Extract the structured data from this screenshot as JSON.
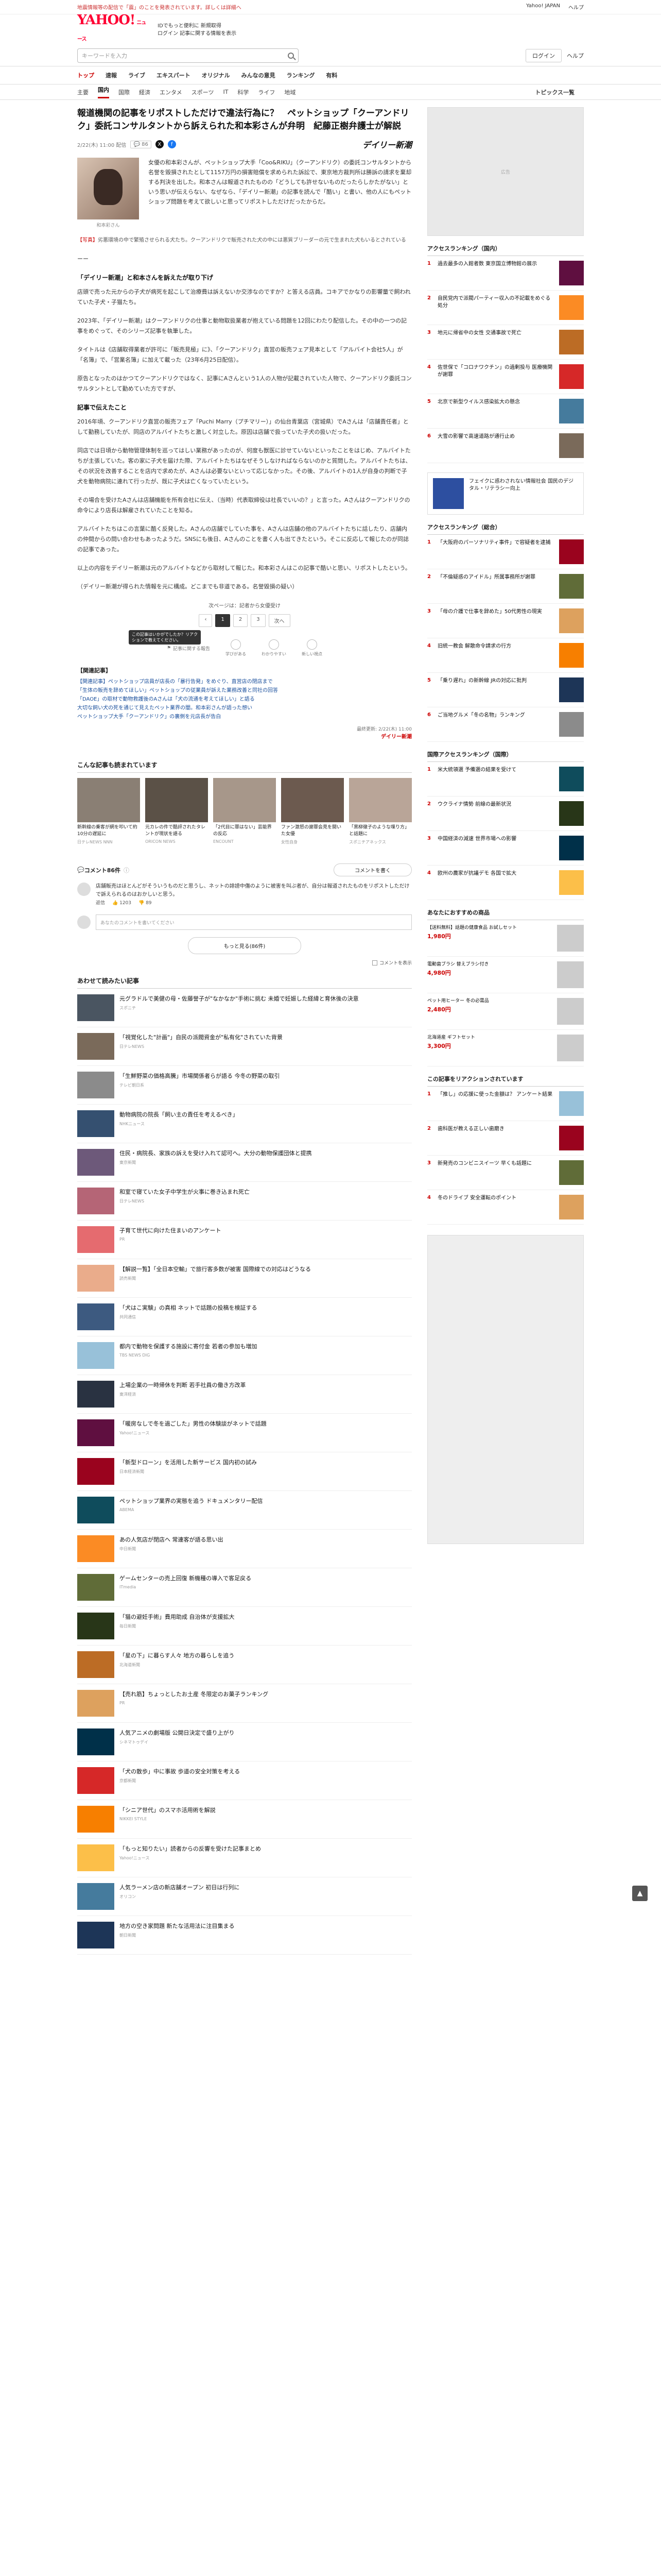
{
  "topbar": {
    "notice": "地震情報等の配信で「震」のことを発表されています。詳しくは詳細へ",
    "links": [
      "Yahoo! JAPAN",
      "ヘルプ"
    ]
  },
  "header": {
    "logo": "YAHOO!",
    "logo_sub": "ニュース",
    "line1": "IDでもっと便利に 新規取得",
    "line2": "ログイン 記事に関する情報を表示"
  },
  "search": {
    "placeholder": "キーワードを入力",
    "login": "ログイン",
    "help": "ヘルプ"
  },
  "gnav": [
    "トップ",
    "速報",
    "ライブ",
    "エキスパート",
    "オリジナル",
    "みんなの意見",
    "ランキング",
    "有料"
  ],
  "snav": [
    "主要",
    "国内",
    "国際",
    "経済",
    "エンタメ",
    "スポーツ",
    "IT",
    "科学",
    "ライフ",
    "地域"
  ],
  "snav_right": "トピックス一覧",
  "article": {
    "title": "報道機関の記事をリポストしただけで違法行為に？　ペットショップ「クーアンドリク」委託コンサルタントから訴えられた和本彩さんが弁明　紀藤正樹弁護士が解説",
    "date": "2/22(木) 11:00 配信",
    "comments": "86",
    "publisher": "デイリー新潮",
    "photo_caption": "和本彩さん",
    "lead": "女優の和本彩さんが、ペットショップ大手「Coo&RIKU」（クーアンドリク）の委託コンサルタントから名誉を毀損されたとして1157万円の損害賠償を求められた訴訟で、東京地方裁判所は勝訴の請求を棄却する判決を出した。和本さんは報道されたものの「どうしても許せないものだったらしかたがない」という思いが伝えらない、なぜなら、「デイリー新潮」の記事を読んで「酷い」と書い、他の人にもペットショップ問題を考えて欲しいと思ってリポストしただけだったからだ。",
    "cap_hl": "【写真】",
    "caption": "劣悪環境の中で繁殖させられる犬たち。クーアンドリクで販売された犬の中には悪質ブリーダーの元で生まれた犬もいるとされている",
    "dash": "ーー",
    "h1": "「デイリー新潮」と和本さんを訴えたが取り下げ",
    "p1": "店頭で売った元からの子犬が病死を起こして治療費は訴えないか交渉なのですか？と答える店員。コキアでかなりの影響量で飼われていた子犬・子猫たち。",
    "p2": "2023年、「デイリー新潮」はクーアンドリクの仕事と動物取扱業者が抱えている問題を12回にわたり配信した。その中の一つの記事をめぐって、そのシリーズ記事を執筆した。",
    "p3": "タイトルは《店舗取得業者が許可に「販売見極」に》、「クーアンドリク」直営の販売フェア見本として「アルバイト会社5人」が「名簿」で、「営業名簿」に加えて載った（23年6月25日配信）。",
    "p4": "原告となったのはかつてクーアンドリクではなく、記事にAさんという1人の人物が記載されていた人物で、クーアンドリク委託コンサルタントとして勤めていた方ですが、",
    "h2": "記事で伝えたこと",
    "p5": "2016年頃、クーアンドリク直営の販売フェア「Puchi Marry（プチマリー）」の仙台青葉店（宮城県）でAさんは「店舗責任者」として勤務していたが、同店のアルバイトたちと激しく対立した。原因は店舗で扱っていた子犬の扱いだった。",
    "p6": "同店では日頃から動物管理体制を巡ってはしい業務があったのが、何度も獣医に診せていないといったことをはじめ、アルバイトたちが主張していた。客の家に子犬を届けた際、アルバイトたちはなぜそうしなければならないのかと質問した。アルバイトたちは、その状況を改善することを店内で求めたが、Aさんは必要ないといって応じなかった。その後、アルバイトの1人が自身の判断で子犬を動物病院に連れて行ったが、既に子犬は亡くなっていたという。",
    "p7": "その場合を受けたAさんは店舗機能を所有会社に伝え、（当時）代表取締役は社長でいいの？」と言った。Aさんはクーアンドリクの命令により店長は解雇されていたことを知る。",
    "p8": "アルバイトたちはこの言葉に酷く反発した。Aさんの店舗でしていた事を、Aさんは店舗の他のアルバイトたちに話したり、店舗内の仲間からの問い合わせもあったようだ。SNSにも後日、Aさんのことを書く人も出てきたという。そこに反応して報じたのが同誌の記事であった。",
    "p9": "以上の内容をデイリー新潮は元のアルバイトなどから取材して報じた。和本彩さんはこの記事で酷いと思い、リポストしたという。",
    "p10": "（デイリー新潮が得られた情報を元に構成。どこまでも非道である。名誉毀損の疑い）",
    "related": "次ページは：記者から女優受け",
    "pager": [
      "1",
      "2",
      "3",
      "次へ"
    ],
    "tooltip": "この記事はいかがでしたか？リアクションで教えてください。",
    "reactions": [
      "学びがある",
      "わかりやすい",
      "新しい視点",
      "新しい視点"
    ],
    "report": "記事に関する報告",
    "rel_head": "【関連記事】",
    "rel_links": [
      "【関連記事】ペットショップ店員が店長の「暴行告発」をめぐり、直営店の閉店まで",
      "「生体の販売を辞めてほしい」ペットショップの従業員が訴えた業務改善と同社の回答",
      "「DAOE」の取材で動物救護後のAさんは「犬の流通を考えてほしい」と語る",
      "大切な飼い犬の死を通じて見えたペット業界の闇。和本彩さんが語った想い",
      "ペットショップ大手「クーアンドリク」の裏側を元店長が告白"
    ],
    "pub_date": "最終更新: 2/22(木) 11:00",
    "pub_name": "デイリー新潮"
  },
  "picks": {
    "title": "こんな記事も読まれています",
    "items": [
      {
        "text": "新幹線の乗客が網を叩いて約10分の遅延に",
        "src": "日テレNEWS NNN"
      },
      {
        "text": "元カレの件で酷評されたタレントが現状を語る",
        "src": "ORICON NEWS"
      },
      {
        "text": "「2代目に罪はない」芸能界の反応",
        "src": "ENCOUNT"
      },
      {
        "text": "ファン激怒の謝罪会見を開いた女優",
        "src": "女性自身"
      },
      {
        "text": "「黒柳徹子のような喋り方」と話題に",
        "src": "スポニチアネックス"
      }
    ]
  },
  "comments": {
    "label": "コメント86件",
    "button": "コメントを書く",
    "first": "店舗販売はほとんどがそういうものだと思うし、ネットの誹謗中傷のように被害を叫ぶ者が、自分は報道されたものをリポストしただけで訴えられるのはおかしいと思う。",
    "stats": [
      "返信",
      "1203",
      "89"
    ],
    "placeholder": "あなたのコメントを書いてください",
    "more": "もっと見る(86件)",
    "hide": "コメントを表示"
  },
  "rec": {
    "title": "あわせて読みたい記事",
    "items": [
      {
        "text": "元グラドルで美健の母・佐藤誉子が\"なかなか\"手術に挑む 未婚で妊娠した経緯と育休後の決意",
        "src": "スポニチ"
      },
      {
        "text": "「視覚化した\"計画\"」自民の派閥資金が\"私有化\"されていた背景",
        "src": "日テレNEWS"
      },
      {
        "text": "「生鮮野菜の価格高騰」市場関係者らが語る 今冬の野菜の取引",
        "src": "テレビ朝日系"
      },
      {
        "text": "動物病院の院長「飼い主の責任を考えるべき」",
        "src": "NHKニュース"
      },
      {
        "text": "住民・病院長、家族の訴えを受け入れて認可へ。大分の動物保護団体と提携",
        "src": "東京新聞"
      },
      {
        "text": "和室で寝ていた女子中学生が火事に巻き込まれ死亡",
        "src": "日テレNEWS"
      },
      {
        "text": "子育て世代に向けた住まいのアンケート",
        "src": "PR"
      },
      {
        "text": "【解説一覧】「全日本空輸」で旅行客多数が被害 国際線での対応はどうなる",
        "src": "読売新聞"
      },
      {
        "text": "「犬はこ実験」の真相 ネットで話題の投稿を検証する",
        "src": "共同通信"
      },
      {
        "text": "都内で動物を保護する施設に寄付金 若者の参加も増加",
        "src": "TBS NEWS DIG"
      },
      {
        "text": "上場企業の一時帰休を判断 若手社員の働き方改革",
        "src": "東洋経済"
      },
      {
        "text": "「暖房なしで冬を過ごした」男性の体験談がネットで話題",
        "src": "Yahoo!ニュース"
      },
      {
        "text": "「新型ドローン」を活用した新サービス 国内初の試み",
        "src": "日本経済新聞"
      },
      {
        "text": "ペットショップ業界の実態を追う ドキュメンタリー配信",
        "src": "ABEMA"
      },
      {
        "text": "あの人気店が閉店へ 常連客が語る思い出",
        "src": "中日新聞"
      },
      {
        "text": "ゲームセンターの売上回復 新機種の導入で客足戻る",
        "src": "ITmedia"
      },
      {
        "text": "「猫の避妊手術」費用助成 自治体が支援拡大",
        "src": "毎日新聞"
      },
      {
        "text": "「星の下」に暮らす人々 地方の暮らしを追う",
        "src": "北海道新聞"
      },
      {
        "text": "【売れ筋】ちょっとしたお土産 冬限定のお菓子ランキング",
        "src": "PR"
      },
      {
        "text": "人気アニメの劇場版 公開日決定で盛り上がり",
        "src": "シネマトゥデイ"
      },
      {
        "text": "「犬の散歩」中に事故 歩道の安全対策を考える",
        "src": "京都新聞"
      },
      {
        "text": "「シニア世代」のスマホ活用術を解説",
        "src": "NIKKEI STYLE"
      },
      {
        "text": "「もっと知りたい」読者からの反響を受けた記事まとめ",
        "src": "Yahoo!ニュース"
      },
      {
        "text": "人気ラーメン店の新店舗オープン 初日は行列に",
        "src": "オリコン"
      },
      {
        "text": "地方の空き家問題 新たな活用法に注目集まる",
        "src": "朝日新聞"
      }
    ]
  },
  "side": {
    "ad": "広告",
    "access_title": "アクセスランキング（国内）",
    "access": [
      "過去最多の入館者数 東京国立博物館の展示",
      "自民党内で派閥パーティー収入の不記載をめぐる処分",
      "地元に帰省中の女性 交通事故で死亡",
      "佐世保で「コロナワクチン」の過剰投与 医療機関が謝罪",
      "北京で新型ウイルス感染拡大の懸念",
      "大雪の影響で高速道路が通行止め"
    ],
    "adcard": "フェイクに惑わされない情報社会 国民のデジタル・リテラシー向上",
    "ranking_title": "アクセスランキング（総合）",
    "ranking": [
      "「大阪府のパーソナリティ事件」で容疑者を逮捕",
      "「不倫疑惑のアイドル」所属事務所が謝罪",
      "「母の介護で仕事を辞めた」50代男性の現実",
      "旧統一教会 解散命令請求の行方",
      "「乗り遅れ」の新幹線 JRの対応に批判",
      "ご当地グルメ「冬の名物」ランキング"
    ],
    "ranking2_title": "国際アクセスランキング（国際）",
    "ranking2": [
      "米大統領選 予備選の結果を受けて",
      "ウクライナ情勢 前線の最新状況",
      "中国経済の減速 世界市場への影響",
      "欧州の農家が抗議デモ 各国で拡大"
    ],
    "shop_title": "あなたにおすすめの商品",
    "shop": [
      {
        "text": "【送料無料】話題の健康食品 お試しセット",
        "price": "1,980円"
      },
      {
        "text": "電動歯ブラシ 替えブラシ付き",
        "price": "4,980円"
      },
      {
        "text": "ペット用ヒーター 冬の必需品",
        "price": "2,480円"
      },
      {
        "text": "北海道産 ギフトセット",
        "price": "3,300円"
      }
    ],
    "reco_title": "この記事をリアクションされています",
    "reco": [
      "「推し」の応援に使った金額は？ アンケート結果",
      "歯科医が教える正しい歯磨き",
      "新発売のコンビニスイーツ 早くも話題に",
      "冬のドライブ 安全運転のポイント"
    ]
  },
  "totop": "▲"
}
